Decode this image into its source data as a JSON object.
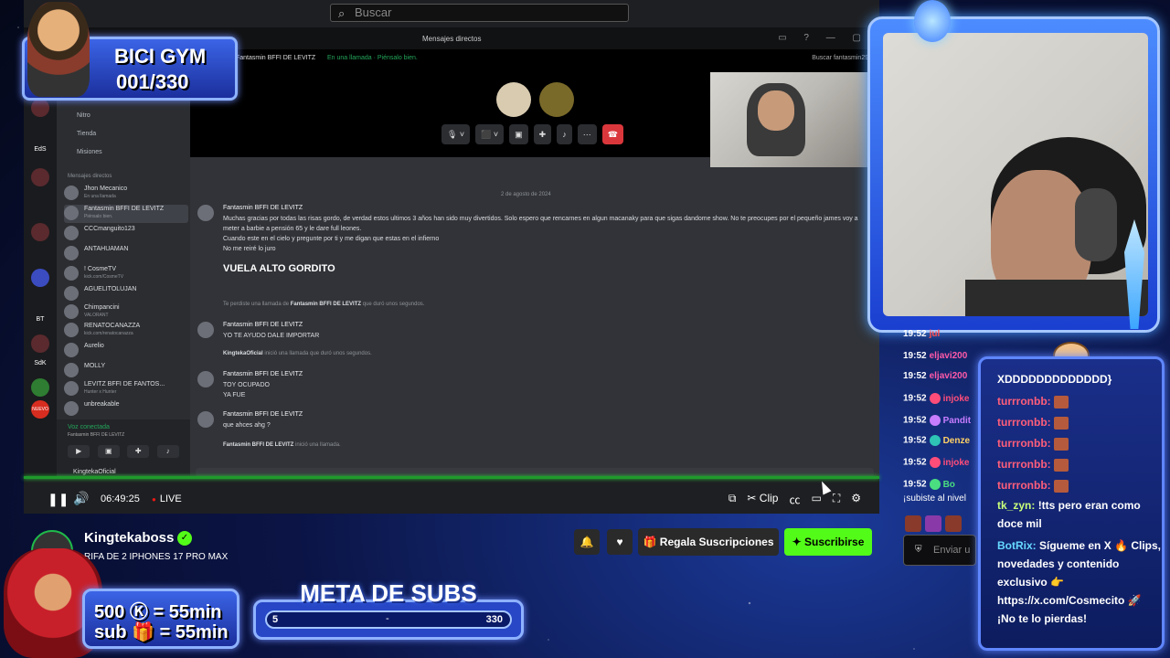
{
  "overlay": {
    "bici_gym": {
      "title": "BICI GYM",
      "counter": "001/330"
    },
    "subs_rates": {
      "row1": "500 Ⓚ = 55min",
      "row2": "sub 🎁 = 55min"
    },
    "meta_subs": {
      "title": "META DE SUBS",
      "min": "5",
      "mid": "-",
      "max": "330",
      "progress_fraction": 0
    }
  },
  "discord": {
    "search_placeholder": "Buscar",
    "window_title": "Mensajes directos",
    "header_user": "Fantasmin BFFI DE LEVITZ",
    "header_status": "En una llamada · Piénsalo bien.",
    "header_search": "Buscar fantasmin297",
    "nav": [
      "Nitro",
      "Tienda",
      "Misiones"
    ],
    "dm_header": "Mensajes directos",
    "dms": [
      {
        "name": "Jhon Mecanico",
        "status": "En una llamada"
      },
      {
        "name": "Fantasmin BFFI DE LEVITZ",
        "status": "Piénsalo bien."
      },
      {
        "name": "CCCmanguito123",
        "status": ""
      },
      {
        "name": "ANTAHUAMAN",
        "status": ""
      },
      {
        "name": "! CosmeTV",
        "status": "kick.com/CosmeTV"
      },
      {
        "name": "AGUELITOLUJAN",
        "status": ""
      },
      {
        "name": "Chimpancini",
        "status": "VALORANT"
      },
      {
        "name": "RENATOCANAZZA",
        "status": "kick.com/renatocanazza"
      },
      {
        "name": "Aurelio",
        "status": ""
      },
      {
        "name": "MOLLY",
        "status": ""
      },
      {
        "name": "LEVITZ BFFI DE FANTOS...",
        "status": "Hunter x Hunter"
      },
      {
        "name": "unbreakable",
        "status": ""
      }
    ],
    "servers": [
      "EdS",
      "BT",
      "SdK",
      "NUEVO"
    ],
    "voice": {
      "status": "Voz conectada",
      "channel": "Fantasmin BFFI DE LEVITZ"
    },
    "current_user": "KingtekaOficial",
    "date_separator": "2 de agosto de 2024",
    "messages": [
      {
        "author": "Fantasmin BFFI DE LEVITZ",
        "text": "Muchas gracias por todas las risas gordo, de verdad estos ultimos 3 años han sido muy divertidos. Solo espero que rencarnes en algun macanaky para que sigas dandome show. No te preocupes por el pequeño james voy a meter a barbie a pensión 65 y le dare full leones.",
        "text2": "Cuando este en el cielo y pregunte por ti y me digan que estas en el infierno",
        "text3": "No me reiré lo juro",
        "big": "VUELA ALTO GORDITO"
      },
      {
        "author": "Fantasmin BFFI DE LEVITZ",
        "text": "YO TE AYUDO DALE IMPORTAR"
      },
      {
        "author": "Fantasmin BFFI DE LEVITZ",
        "text": "TOY OCUPADO",
        "text2": "YA FUE"
      },
      {
        "author": "Fantasmin BFFI DE LEVITZ",
        "text": "que ahces ahg ?"
      }
    ],
    "system": [
      {
        "pre": "Te perdiste una llamada de ",
        "who": "Fantasmin BFFI DE LEVITZ",
        "post": " que duró unos segundos."
      },
      {
        "pre": "",
        "who": "KingtekaOficial",
        "post": " inició una llamada que duró unos segundos."
      },
      {
        "pre": "",
        "who": "Fantasmin BFFI DE LEVITZ",
        "post": " inició una llamada."
      }
    ]
  },
  "player": {
    "time": "06:49:25",
    "live": "LIVE",
    "clip": "Clip",
    "progress_fraction": 1.0
  },
  "stream": {
    "channel_name": "Kingtekaboss",
    "title": "RIFA DE 2 IPHONES 17 PRO MAX",
    "gift_label": "Regala Suscripciones",
    "subscribe_label": "Suscribirse"
  },
  "mid_chat": {
    "rows": [
      {
        "time": "19:52",
        "user": "jul",
        "color": "#ff4d4d"
      },
      {
        "time": "19:52",
        "user": "eljavi200",
        "color": "#ff5aa8"
      },
      {
        "time": "19:52",
        "user": "eljavi200",
        "color": "#ff5aa8"
      },
      {
        "time": "19:52",
        "user": "injoke",
        "color": "#ff4d7a"
      },
      {
        "time": "19:52",
        "user": "Pandit",
        "color": "#c77dff"
      },
      {
        "time": "19:52",
        "user": "Denze",
        "color": "#ffd166"
      },
      {
        "time": "19:52",
        "user": "injoke",
        "color": "#ff4d7a"
      },
      {
        "time": "19:52",
        "user": "Bo",
        "color": "#4ade80"
      }
    ],
    "sub_text": "¡subiste al nivel",
    "send_placeholder": "Enviar u"
  },
  "right_chat": {
    "lines": [
      {
        "user": "",
        "text": "XDDDDDDDDDDDDD}"
      },
      {
        "user": "turrronbb:",
        "text": ""
      },
      {
        "user": "turrronbb:",
        "text": ""
      },
      {
        "user": "turrronbb:",
        "text": ""
      },
      {
        "user": "turrronbb:",
        "text": ""
      },
      {
        "user": "turrronbb:",
        "text": ""
      }
    ],
    "tk_user": "tk_zyn:",
    "tk_text": "!tts pero eran como doce mil",
    "bot_user": "BotRix:",
    "bot_text": "Sígueme en X 🔥 Clips, novedades y contenido exclusivo 👉 https://x.com/Cosmecito 🚀 ¡No te lo pierdas!"
  }
}
